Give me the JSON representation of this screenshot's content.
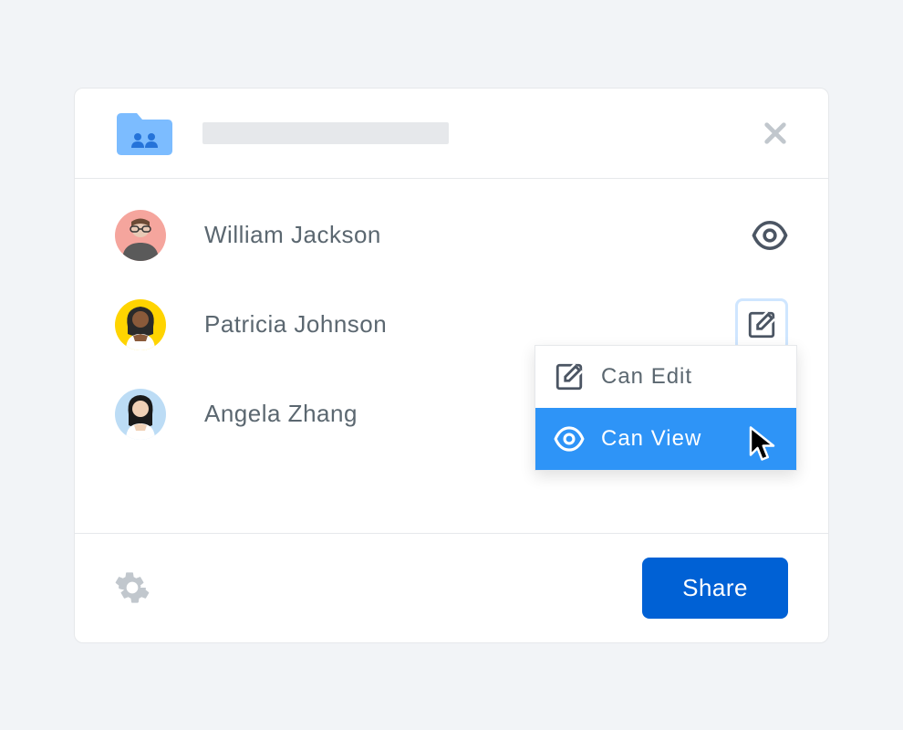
{
  "header": {
    "folder_icon_name": "shared-folder-icon",
    "close_icon_name": "close-icon"
  },
  "users": [
    {
      "name": "William Jackson",
      "permission": "view",
      "avatar_color": "#f5a59d",
      "avatar_icon": "man-glasses"
    },
    {
      "name": "Patricia Johnson",
      "permission": "edit",
      "avatar_color": "#ffd400",
      "avatar_icon": "woman-1"
    },
    {
      "name": "Angela Zhang",
      "permission": "menu-open",
      "avatar_color": "#bcdcf5",
      "avatar_icon": "woman-2"
    }
  ],
  "dropdown": {
    "options": [
      {
        "label": "Can Edit",
        "icon": "edit",
        "selected": false
      },
      {
        "label": "Can View",
        "icon": "view",
        "selected": true
      }
    ]
  },
  "footer": {
    "settings_icon_name": "gear-icon",
    "share_button_label": "Share"
  },
  "colors": {
    "primary": "#0061d5",
    "highlight": "#2e94f7",
    "folder": "#7cbcff"
  }
}
